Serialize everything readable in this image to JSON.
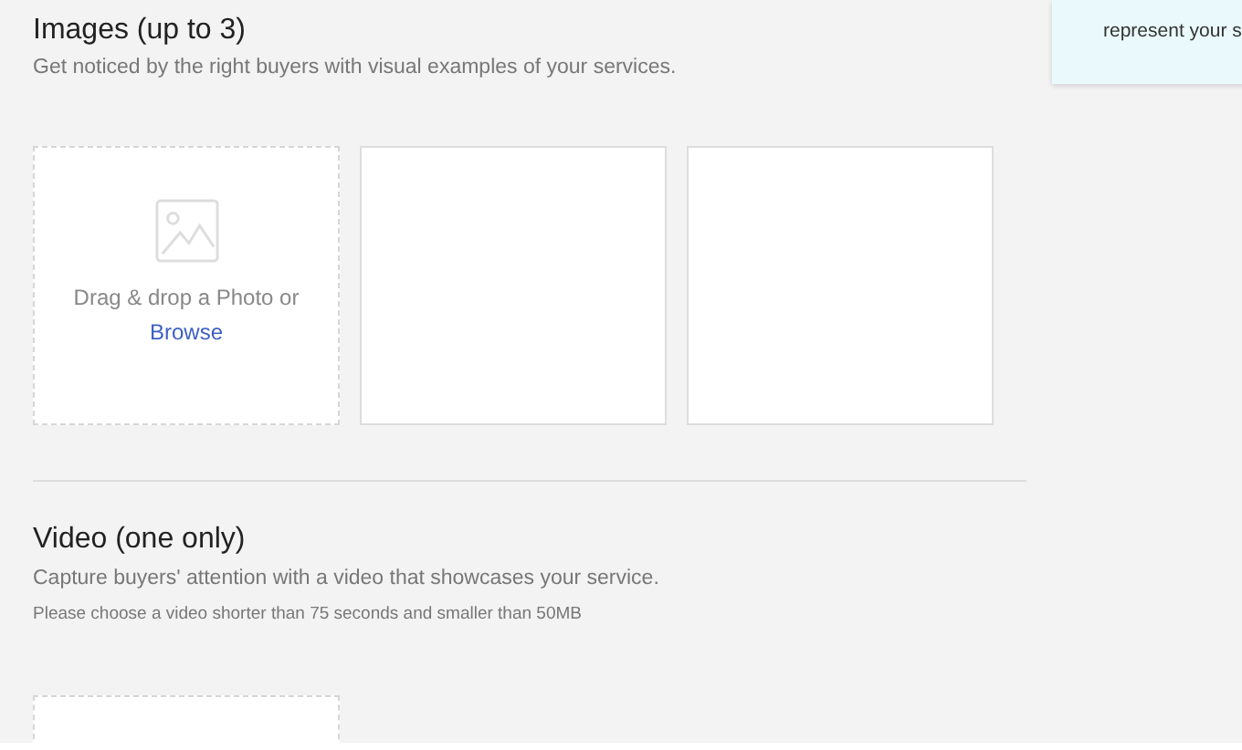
{
  "images": {
    "title": "Images (up to 3)",
    "description": "Get noticed by the right buyers with visual examples of your services.",
    "slots": [
      {
        "kind": "dropzone",
        "prompt": "Drag & drop a Photo or",
        "link": "Browse"
      },
      {
        "kind": "empty"
      },
      {
        "kind": "empty"
      }
    ]
  },
  "video": {
    "title": "Video (one only)",
    "description": "Capture buyers' attention with a video that showcases your service.",
    "note": "Please choose a video shorter than 75 seconds and smaller than 50MB",
    "slots": [
      {
        "kind": "dropzone"
      }
    ]
  },
  "tooltip": {
    "text": "represent your s"
  }
}
